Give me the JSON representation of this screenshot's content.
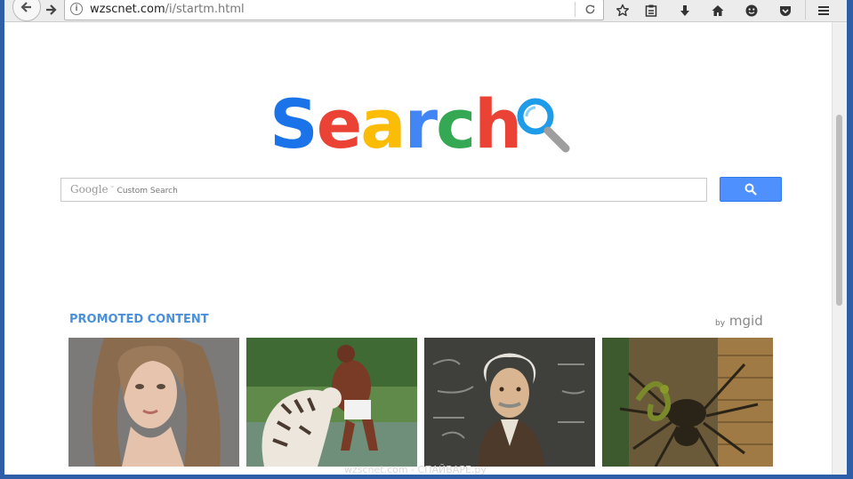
{
  "browser": {
    "url_host": "wzscnet.com",
    "url_path": "/i/startm.html"
  },
  "logo": {
    "letters": [
      "S",
      "e",
      "a",
      "r",
      "c",
      "h"
    ],
    "colors": [
      "#1a73e8",
      "#ea4335",
      "#fbbc05",
      "#4285f4",
      "#34a853",
      "#ea4335"
    ]
  },
  "search": {
    "placeholder_brand": "Google",
    "placeholder_text": "Custom Search"
  },
  "promoted": {
    "title": "PROMOTED CONTENT",
    "by_label": "by",
    "brand": "mgid"
  },
  "watermark": "wzscnet.com - СПАЙВАРЕ.ру",
  "colors": {
    "accent": "#4d90fe",
    "promo_title": "#4a90d9",
    "desktop": "#2f5ea8"
  }
}
